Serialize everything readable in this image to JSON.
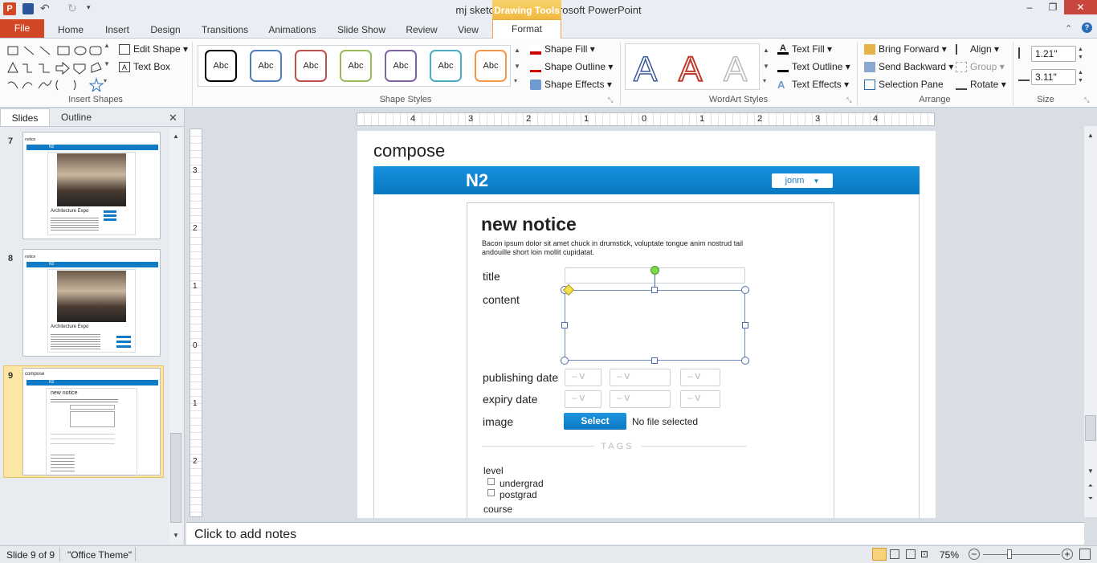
{
  "window": {
    "title": "mj sketches.pptx - Microsoft PowerPoint",
    "context_header": "Drawing Tools"
  },
  "tabs": [
    "File",
    "Home",
    "Insert",
    "Design",
    "Transitions",
    "Animations",
    "Slide Show",
    "Review",
    "View",
    "Format"
  ],
  "ribbon": {
    "insert_shapes": {
      "edit_shape": "Edit Shape",
      "text_box": "Text Box",
      "label": "Insert Shapes"
    },
    "shape_styles": {
      "sample": "Abc",
      "colors": [
        "#000000",
        "#4f81bd",
        "#c0504d",
        "#9bbb59",
        "#8064a2",
        "#4bacc6",
        "#f79646"
      ],
      "fill": "Shape Fill",
      "outline": "Shape Outline",
      "effects": "Shape Effects",
      "label": "Shape Styles"
    },
    "wordart": {
      "text_fill": "Text Fill",
      "text_outline": "Text Outline",
      "text_effects": "Text Effects",
      "label": "WordArt Styles"
    },
    "arrange": {
      "bring_forward": "Bring Forward",
      "send_backward": "Send Backward",
      "selection_pane": "Selection Pane",
      "align": "Align",
      "group": "Group",
      "rotate": "Rotate",
      "label": "Arrange"
    },
    "size": {
      "height": "1.21\"",
      "width": "3.11\"",
      "label": "Size"
    }
  },
  "panel": {
    "tab_slides": "Slides",
    "tab_outline": "Outline",
    "slides": [
      {
        "num": "7",
        "title": "notice",
        "brand": "N2",
        "heading": "Architecture Expo"
      },
      {
        "num": "8",
        "title": "notice",
        "brand": "N2",
        "heading": "Architecture Expo"
      },
      {
        "num": "9",
        "title": "compose",
        "brand": "N2",
        "heading": "new notice"
      }
    ]
  },
  "ruler": {
    "h_ticks": [
      "4",
      "3",
      "2",
      "1",
      "0",
      "1",
      "2",
      "3",
      "4"
    ],
    "v_ticks": [
      "3",
      "2",
      "1",
      "0",
      "1",
      "2"
    ]
  },
  "slide": {
    "title": "compose",
    "header": {
      "brand": "N2",
      "user": "jonm",
      "caret": "▼"
    },
    "form": {
      "heading": "new notice",
      "intro": "Bacon ipsum dolor sit amet chuck in drumstick, voluptate tongue anim nostrud tail andouille short loin mollit cupidatat.",
      "title_label": "title",
      "content_label": "content",
      "publishing_label": "publishing date",
      "expiry_label": "expiry date",
      "image_label": "image",
      "date_placeholder": "-- V",
      "select_btn": "Select",
      "no_file": "No file selected",
      "tags_label": "TAGS",
      "level_label": "level",
      "level_options": [
        "undergrad",
        "postgrad"
      ],
      "course_label": "course"
    }
  },
  "notes": {
    "placeholder": "Click to add notes"
  },
  "status": {
    "slide": "Slide 9 of 9",
    "theme": "\"Office Theme\"",
    "zoom": "75%"
  }
}
